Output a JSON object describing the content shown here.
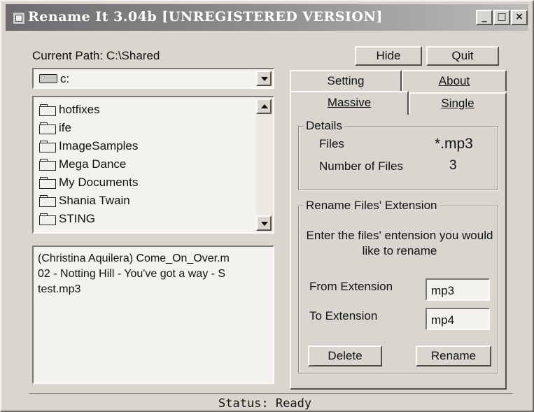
{
  "title": "Rename It 3.04b [UNREGISTERED VERSION]",
  "titlebar_buttons": {
    "minimize": "_",
    "maximize": "□",
    "close": "×"
  },
  "current_path": "Current Path: C:\\Shared",
  "drive": {
    "icon": "drive-icon",
    "value": "c:"
  },
  "folders": [
    "hotfixes",
    "ife",
    "ImageSamples",
    "Mega Dance",
    "My Documents",
    "Shania Twain",
    "STING"
  ],
  "files": [
    "(Christina Aquilera) Come_On_Over.m",
    "02 - Notting Hill - You've got a way - S",
    "test.mp3"
  ],
  "buttons": {
    "hide": "Hide",
    "quit": "Quit",
    "delete": "Delete",
    "rename": "Rename"
  },
  "tabs": {
    "setting": "Setting",
    "about": "About",
    "massive": "Massive",
    "single": "Single"
  },
  "details": {
    "title": "Details",
    "files_label": "Files",
    "files_value": "*.mp3",
    "count_label": "Number of Files",
    "count_value": "3"
  },
  "rename_ext": {
    "title": "Rename Files' Extension",
    "instructions": "Enter the files' entension you would like to rename",
    "from_label": "From Extension",
    "from_value": "mp3",
    "to_label": "To Extension",
    "to_value": "mp4"
  },
  "status": "Status: Ready"
}
